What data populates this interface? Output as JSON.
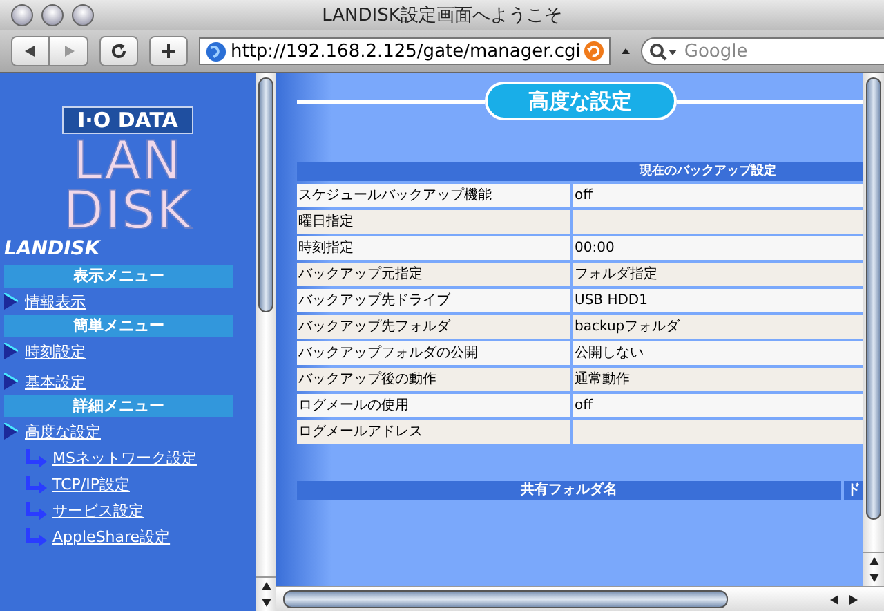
{
  "window": {
    "title": "LANDISK設定画面へようこそ"
  },
  "toolbar": {
    "url": "http://192.168.2.125/gate/manager.cgi",
    "search": {
      "placeholder": "Google"
    }
  },
  "sidebar": {
    "logo": {
      "maker": "I·O DATA",
      "product": [
        "LAN",
        "DISK"
      ]
    },
    "title": "LANDISK",
    "sections": [
      {
        "heading": "表示メニュー",
        "items": [
          {
            "label": "情報表示"
          }
        ]
      },
      {
        "heading": "簡単メニュー",
        "items": [
          {
            "label": "時刻設定"
          },
          {
            "label": "基本設定"
          }
        ]
      },
      {
        "heading": "詳細メニュー",
        "items": [
          {
            "label": "高度な設定",
            "children": [
              {
                "label": "MSネットワーク設定"
              },
              {
                "label": "TCP/IP設定"
              },
              {
                "label": "サービス設定"
              },
              {
                "label": "AppleShare設定"
              }
            ]
          }
        ]
      }
    ]
  },
  "main": {
    "title": "高度な設定",
    "backup_table": {
      "heading": "現在のバックアップ設定",
      "rows": [
        {
          "label": "スケジュールバックアップ機能",
          "value": "off"
        },
        {
          "label": "曜日指定",
          "value": ""
        },
        {
          "label": "時刻指定",
          "value": "00:00"
        },
        {
          "label": "バックアップ元指定",
          "value": "フォルダ指定"
        },
        {
          "label": "バックアップ先ドライブ",
          "value": "USB HDD1"
        },
        {
          "label": "バックアップ先フォルダ",
          "value": "backupフォルダ"
        },
        {
          "label": "バックアップフォルダの公開",
          "value": "公開しない"
        },
        {
          "label": "バックアップ後の動作",
          "value": "通常動作"
        },
        {
          "label": "ログメールの使用",
          "value": "off"
        },
        {
          "label": "ログメールアドレス",
          "value": ""
        }
      ]
    },
    "share_table": {
      "columns": [
        "共有フォルダ名",
        "ド"
      ]
    }
  }
}
